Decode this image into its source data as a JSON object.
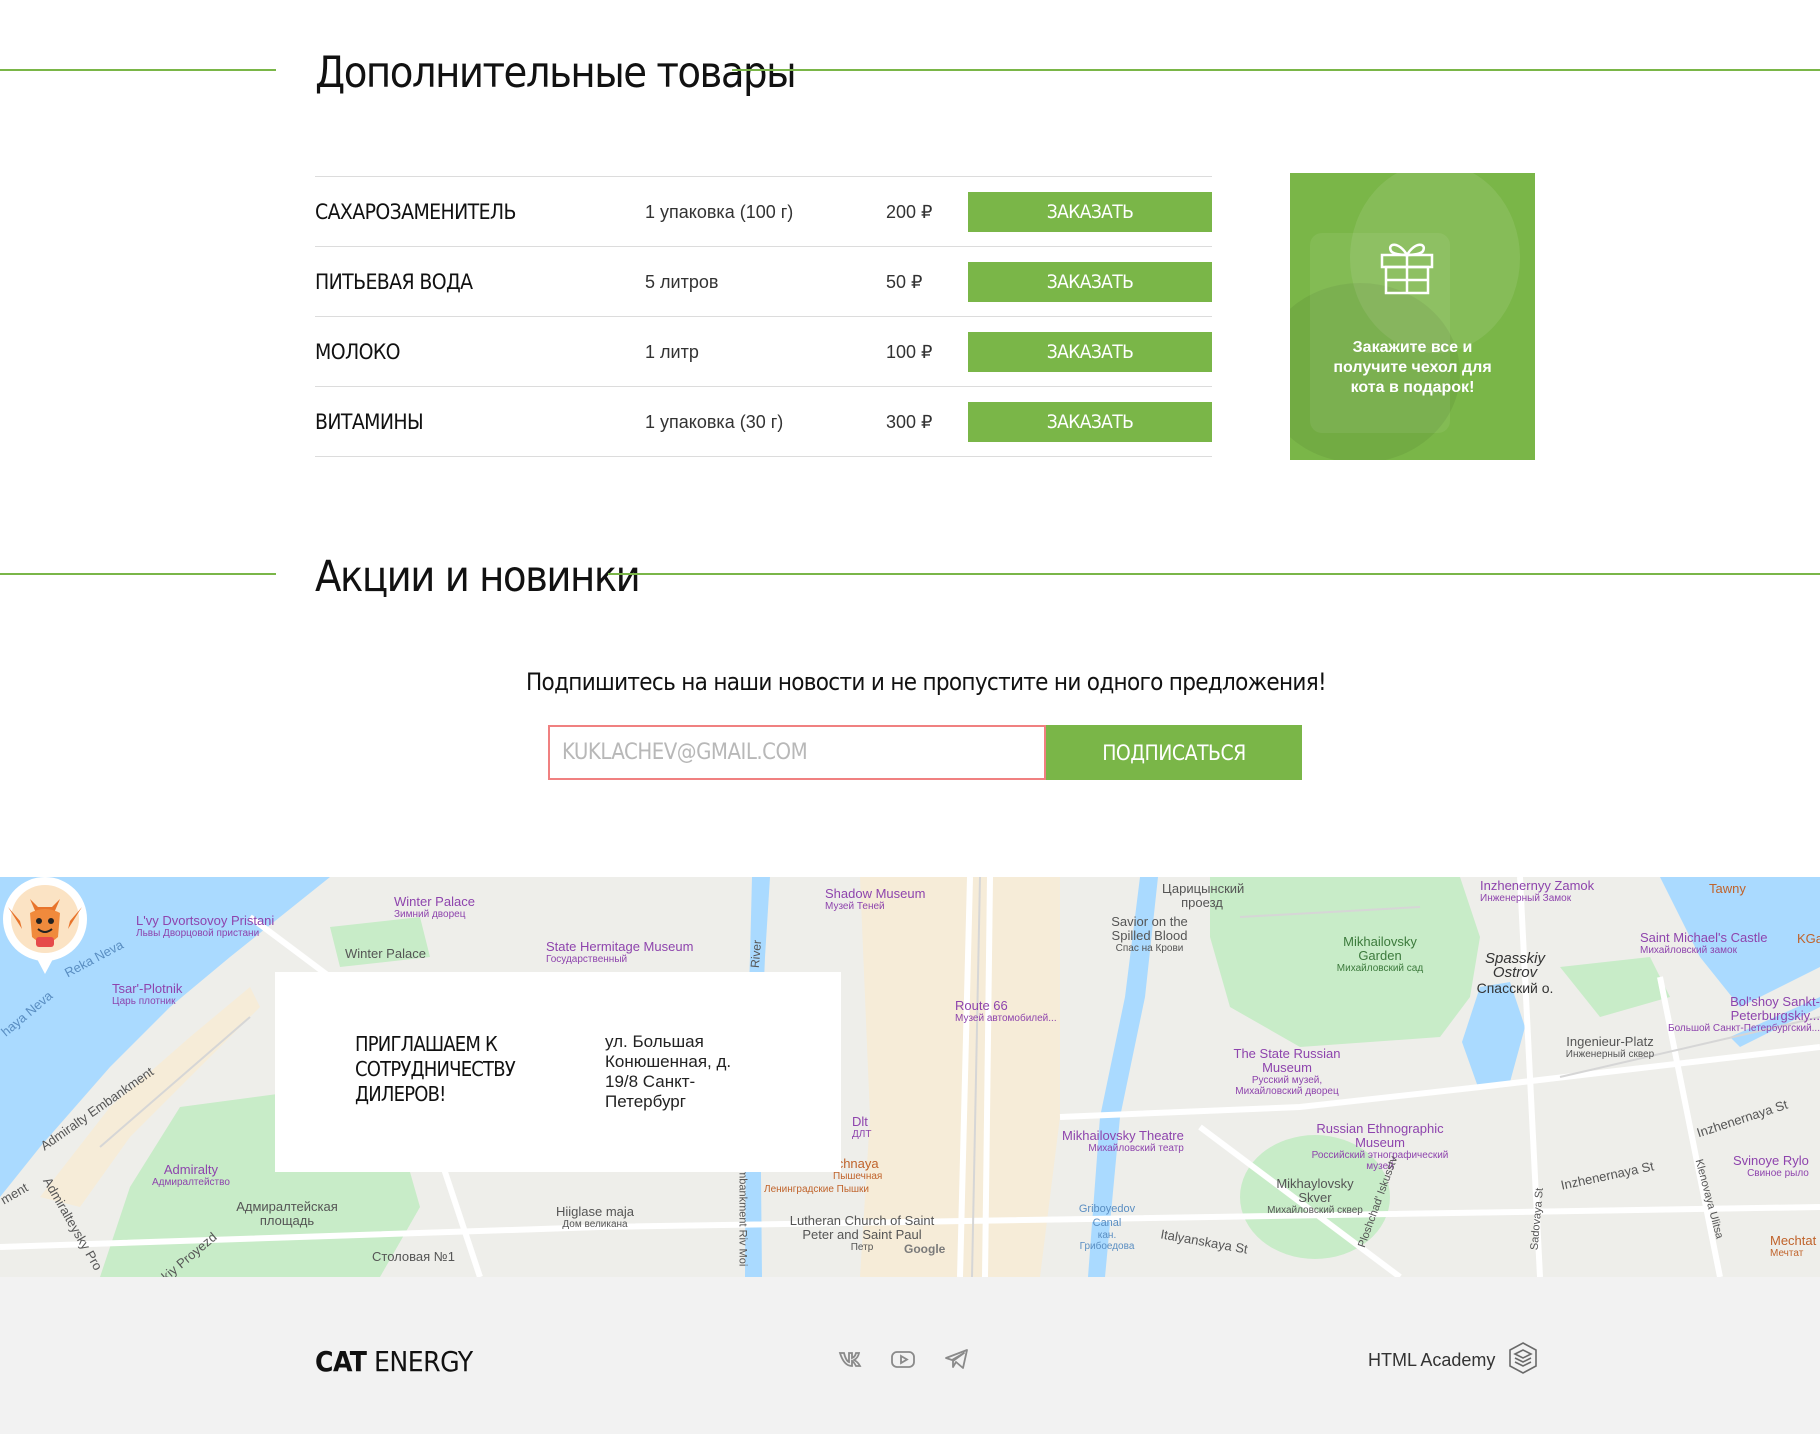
{
  "sections": {
    "extra_title": "Дополнительные товары",
    "promo_title": "Акции и новинки"
  },
  "products": [
    {
      "name": "Сахарозаменитель",
      "qty": "1 упаковка (100 г)",
      "price": "200 ₽",
      "button": "Заказать"
    },
    {
      "name": "Питьевая вода",
      "qty": "5 литров",
      "price": "50 ₽",
      "button": "Заказать"
    },
    {
      "name": "Молоко",
      "qty": "1 литр",
      "price": "100 ₽",
      "button": "Заказать"
    },
    {
      "name": "Витамины",
      "qty": "1 упаковка (30 г)",
      "price": "300 ₽",
      "button": "Заказать"
    }
  ],
  "promo_card": {
    "icon": "gift-icon",
    "text": "Закажите все и получите чехол для кота в подарок!"
  },
  "subscribe": {
    "title": "Подпишитесь на наши новости и не пропустите ни одного предложения!",
    "placeholder": "kuklachev@gmail.com",
    "button": "Подписаться"
  },
  "dealer": {
    "title": "Приглашаем к сотрудничеству дилеров!",
    "address": "ул. Большая Конюшенная, д. 19/8 Санкт-Петербург"
  },
  "map_labels": {
    "winter_palace": "Winter Palace",
    "winter_palace_ru": "Зимний дворец",
    "winter_palace2": "Winter Palace",
    "lvy": "L'vy Dvortsovoy Pristani",
    "lvy_ru": "Львы Дворцовой пристани",
    "reka_neva": "Reka Neva",
    "haya_neva": "haya Neva",
    "tsar": "Tsar'-Plotnik",
    "tsar_ru": "Царь плотник",
    "hermitage": "State Hermitage Museum",
    "hermitage_ru": "Государственный",
    "shadow": "Shadow Museum",
    "shadow_ru": "Музей Теней",
    "tsaritsynsky": "Царицынский проезд",
    "savior": "Savior on the Spilled Blood",
    "savior_ru": "Спас на Крови",
    "inzh_zamok": "Inzhenernyy Zamok",
    "inzh_zamok_ru": "Инженерный Замок",
    "tawny": "Tawny",
    "mikh_garden": "Mikhailovsky Garden",
    "mikh_garden_ru": "Михайловский сад",
    "spassky": "Spasskiy Ostrov",
    "spassky_ru": "Спасский о.",
    "st_michael": "Saint Michael's Castle",
    "st_michael_ru": "Михайловский замок",
    "route66": "Route 66",
    "route66_ru": "Музей автомобилей...",
    "russian_museum": "The State Russian Museum",
    "russian_museum_ru": "Русский музей, Михайловский дворец",
    "bolshoy": "Bol'shoy Sankt-Peterburgskiy...",
    "bolshoy_ru": "Большой Санкт-Петербургский...",
    "ingenieur": "Ingenieur-Platz",
    "ingenieur_ru": "Инженерный сквер",
    "admiralty_emb": "Admiralty Embankment",
    "admiralty": "Admiralty",
    "admiralty_ru": "Адмиралтейство",
    "adm_square": "Адмиралтейская площадь",
    "mikh_theatre": "Mikhailovsky Theatre",
    "mikh_theatre_ru": "Михайловский театр",
    "ethno": "Russian Ethnographic Museum",
    "ethno_ru": "Российский этнографический музей",
    "inzhenernaya": "Inzhenernaya St",
    "inzhenernaya2": "Inzhenernaya St",
    "svinoye": "Svinoye Rylo",
    "svinoye_ru": "Свиное рыло",
    "dlt": "Dlt",
    "dlt_ru": "ДЛТ",
    "pyshechnaya": "chnaya",
    "pyshechnaya_ru": "Пышечная",
    "leningradskie": "Ленинградские Пышки",
    "hiiglase": "Hiiglase maja",
    "hiiglase_ru": "Дом великана",
    "lutheran": "Lutheran Church of Saint Peter and Saint Paul",
    "lutheran_ru": "Петр",
    "stolovaya": "Столовая №1",
    "griboedov": "Griboyedov Canal",
    "griboedov_ru": "кан. Грибоедова",
    "italyanskaya": "Italyanskaya St",
    "mikh_skver": "Mikhaylovsky Skver",
    "mikh_skver_ru": "Михайловский сквер",
    "iskusstv": "Ploshchad' Iskusstv",
    "sadovaya": "Sadovaya St",
    "klenovaya": "Klenovaya Ulitsa",
    "mechtat": "Mechtat",
    "mechtat_ru": "Мечтат",
    "kga": "KGa",
    "river": "River",
    "embankment": "Embankment Riv Moi",
    "adm_proezd": "skiy Proyezd",
    "admiralteysky_pr": "Admiralteysky Pro",
    "ment": "ment",
    "google": "Google"
  },
  "footer": {
    "logo_bold": "CAT",
    "logo_rest": " ENERGY",
    "social": [
      "vk-icon",
      "youtube-icon",
      "telegram-icon"
    ],
    "academy": "HTML Academy"
  },
  "colors": {
    "accent": "#7ab648",
    "input_border": "#f08080",
    "footer_bg": "#f2f2f2",
    "map_water": "#aadaff",
    "map_park": "#c8ecc8"
  }
}
